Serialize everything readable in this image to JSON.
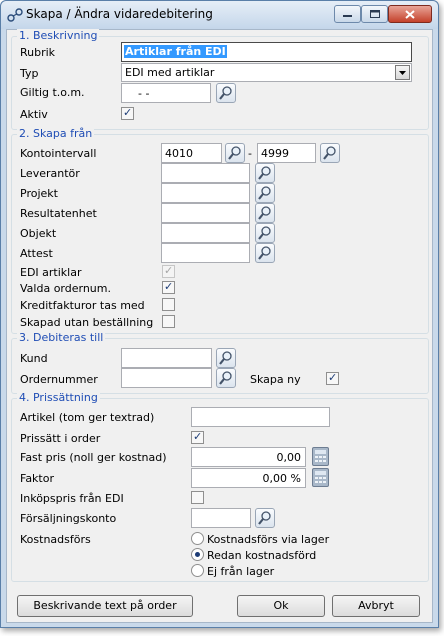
{
  "window": {
    "title": "Skapa / Ändra vidaredebitering"
  },
  "s1": {
    "legend": "1. Beskrivning",
    "rubrik_label": "Rubrik",
    "rubrik_value": "Artiklar från EDI",
    "typ_label": "Typ",
    "typ_value": "EDI med artiklar",
    "giltig_label": "Giltig t.o.m.",
    "giltig_value": "- -",
    "aktiv_label": "Aktiv"
  },
  "s2": {
    "legend": "2. Skapa från",
    "konto_label": "Kontointervall",
    "konto_from": "4010",
    "konto_dash": "-",
    "konto_to": "4999",
    "leverantor_label": "Leverantör",
    "projekt_label": "Projekt",
    "resultatenhet_label": "Resultatenhet",
    "objekt_label": "Objekt",
    "attest_label": "Attest",
    "edi_label": "EDI artiklar",
    "valda_label": "Valda ordernum.",
    "kredit_label": "Kreditfakturor tas med",
    "skapad_label": "Skapad utan beställning"
  },
  "s3": {
    "legend": "3. Debiteras till",
    "kund_label": "Kund",
    "ordernummer_label": "Ordernummer",
    "skapa_ny_label": "Skapa ny"
  },
  "s4": {
    "legend": "4. Prissättning",
    "artikel_label": "Artikel (tom ger textrad)",
    "prissatt_label": "Prissätt i order",
    "fast_label": "Fast pris (noll ger kostnad)",
    "fast_value": "0,00",
    "faktor_label": "Faktor",
    "faktor_value": "0,00 %",
    "inkops_label": "Inköpspris från EDI",
    "forsaljning_label": "Försäljningskonto",
    "kostnad_label": "Kostnadsförs",
    "radio_options": [
      "Kostnadsförs via lager",
      "Redan kostnadsförd",
      "Ej från lager"
    ],
    "radio_selected": "Redan kostnadsförd"
  },
  "buttons": {
    "beskrivande": "Beskrivande text på order",
    "ok": "Ok",
    "avbryt": "Avbryt"
  },
  "icons": {
    "lookup": "magnifier-icon",
    "calculator": "calculator-icon",
    "check": "✓"
  },
  "colors": {
    "legend": "#1f4db5",
    "selection": "#3399ff",
    "client_bg": "#f0f0f0",
    "titlebar": "#c4d6ea"
  }
}
